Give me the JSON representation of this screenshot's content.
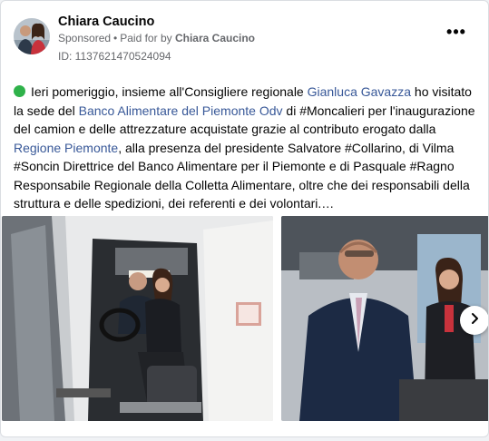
{
  "advertiser": {
    "name": "Chiara Caucino",
    "sponsored_label": "Sponsored",
    "paid_for_prefix": "Paid for by",
    "paid_for_name": "Chiara Caucino",
    "ad_id": "ID: 1137621470524094"
  },
  "more_label": "•••",
  "post": {
    "seg1": "Ieri pomeriggio, insieme all'Consigliere regionale ",
    "link1": "Gianluca Gavazza",
    "seg2": " ho visitato la sede del ",
    "link2": "Banco Alimentare del Piemonte Odv",
    "seg3": " di #Moncalieri per l'inaugurazione del camion e delle attrezzature acquistate grazie al contributo erogato dalla ",
    "link3": "Regione Piemonte",
    "seg4": ", alla presenza del presidente Salvatore #Collarino, di Vilma #Soncin Direttrice del Banco Alimentare per il Piemonte e di Pasquale #Ragno Responsabile Regionale della Colletta Alimentare, oltre che dei responsabili della struttura e delle spedizioni, dei referenti e dei volontari.…"
  },
  "colors": {
    "link": "#385898",
    "status_dot": "#2fb24a",
    "secondary_text": "#65676b"
  },
  "icons": {
    "status": "green-circle-icon",
    "more": "more-options-icon",
    "next": "chevron-right-icon"
  }
}
